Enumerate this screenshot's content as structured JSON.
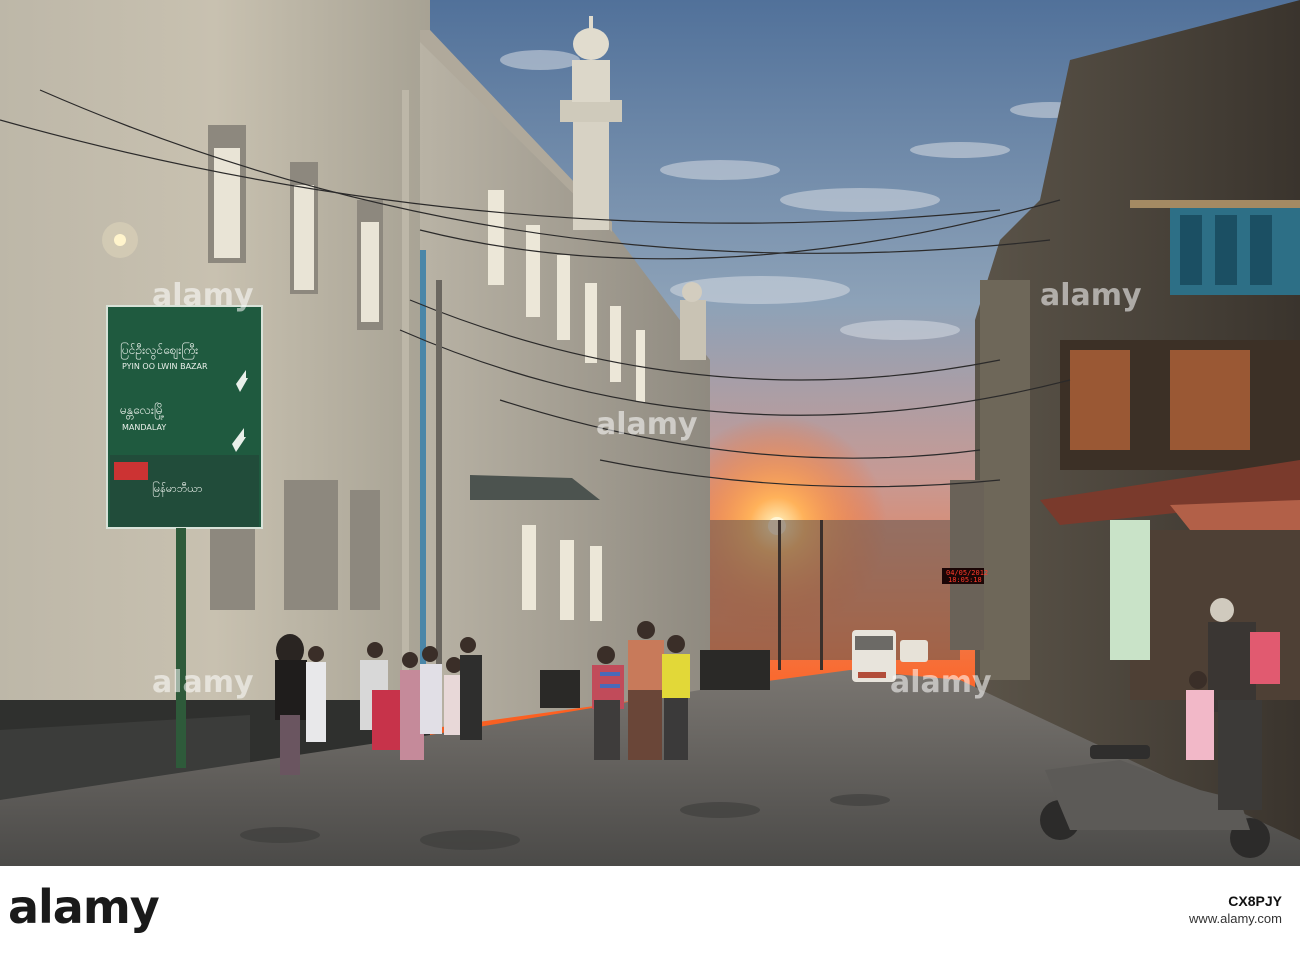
{
  "watermarks": {
    "left": "alamy",
    "middle": "alamy",
    "right": "alamy",
    "bottom_left": "alamy",
    "bottom_right": "alamy"
  },
  "street_sign": {
    "line1_burmese": "ပြင်ဦးလွင်စျေးကြီး",
    "line1_latin": "PYIN OO LWIN BAZAR",
    "line2_burmese": "မန္တလေးမြို့",
    "line2_latin": "MANDALAY",
    "ad_text": "မြန်မာဘီယာ"
  },
  "clock_display": {
    "date": "04/05/2012",
    "time": "18:05:18"
  },
  "footer": {
    "brand": "alamy",
    "stock_line": "www.alamy.com",
    "image_code": "CX8PJY"
  },
  "colors": {
    "sky_top": "#5f7a9e",
    "sunset": "#ff6a2a",
    "building": "#d8d2c2",
    "sign_green": "#1f5a3f",
    "street": "#5e5d5c"
  }
}
